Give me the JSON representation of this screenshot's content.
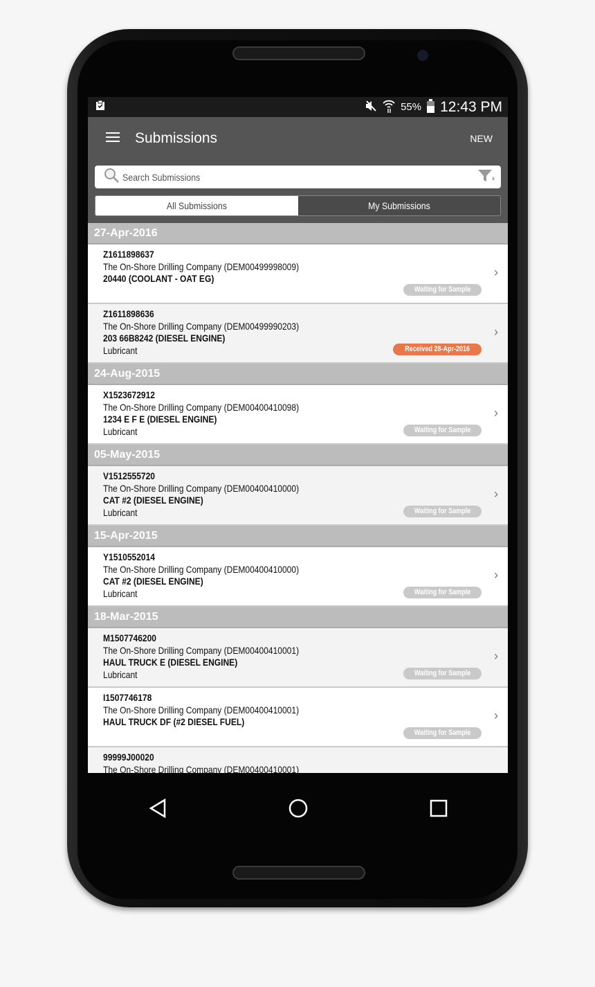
{
  "status_bar": {
    "battery": "55%",
    "time": "12:43 PM",
    "icons": [
      "clipboard-check-icon",
      "mute-icon",
      "wifi-icon",
      "battery-icon"
    ]
  },
  "app_bar": {
    "title": "Submissions",
    "new_label": "NEW"
  },
  "search": {
    "placeholder": "Search Submissions"
  },
  "tabs": [
    {
      "label": "All Submissions",
      "selected": true
    },
    {
      "label": "My Submissions",
      "selected": false
    }
  ],
  "colors": {
    "waiting": "#c9c9c9",
    "received": "#e8774a",
    "header": "#555555",
    "group": "#bcbcbc"
  },
  "groups": [
    {
      "date": "27-Apr-2016",
      "items": [
        {
          "id": "Z1611898637",
          "company": "The On-Shore Drilling Company (DEM00499998009)",
          "equipment": "20440 (COOLANT - OAT EG)",
          "type": "",
          "status": "Waiting for Sample",
          "status_kind": "waiting"
        },
        {
          "id": "Z1611898636",
          "company": "The On-Shore Drilling Company (DEM00499990203)",
          "equipment": "203 66B8242 (DIESEL ENGINE)",
          "type": "Lubricant",
          "status": "Received 28-Apr-2016",
          "status_kind": "received"
        }
      ]
    },
    {
      "date": "24-Aug-2015",
      "items": [
        {
          "id": "X1523672912",
          "company": "The On-Shore Drilling Company (DEM00400410098)",
          "equipment": "1234 E F E (DIESEL ENGINE)",
          "type": "Lubricant",
          "status": "Waiting for Sample",
          "status_kind": "waiting"
        }
      ]
    },
    {
      "date": "05-May-2015",
      "items": [
        {
          "id": "V1512555720",
          "company": "The On-Shore Drilling Company (DEM00400410000)",
          "equipment": "CAT #2 (DIESEL ENGINE)",
          "type": "Lubricant",
          "status": "Waiting for Sample",
          "status_kind": "waiting"
        }
      ]
    },
    {
      "date": "15-Apr-2015",
      "items": [
        {
          "id": "Y1510552014",
          "company": "The On-Shore Drilling Company (DEM00400410000)",
          "equipment": "CAT #2 (DIESEL ENGINE)",
          "type": "Lubricant",
          "status": "Waiting for Sample",
          "status_kind": "waiting"
        }
      ]
    },
    {
      "date": "18-Mar-2015",
      "items": [
        {
          "id": "M1507746200",
          "company": "The On-Shore Drilling Company (DEM00400410001)",
          "equipment": "HAUL TRUCK E (DIESEL ENGINE)",
          "type": "Lubricant",
          "status": "Waiting for Sample",
          "status_kind": "waiting"
        },
        {
          "id": "I1507746178",
          "company": "The On-Shore Drilling Company (DEM00400410001)",
          "equipment": "HAUL TRUCK DF (#2 DIESEL FUEL)",
          "type": "",
          "status": "Waiting for Sample",
          "status_kind": "waiting"
        },
        {
          "id": "99999J00020",
          "company": "The On-Shore Drilling Company (DEM00400410001)",
          "equipment": "",
          "type": "",
          "status": "",
          "status_kind": ""
        }
      ]
    }
  ],
  "nav": {
    "icons": [
      "back-icon",
      "home-icon",
      "recents-icon"
    ]
  }
}
